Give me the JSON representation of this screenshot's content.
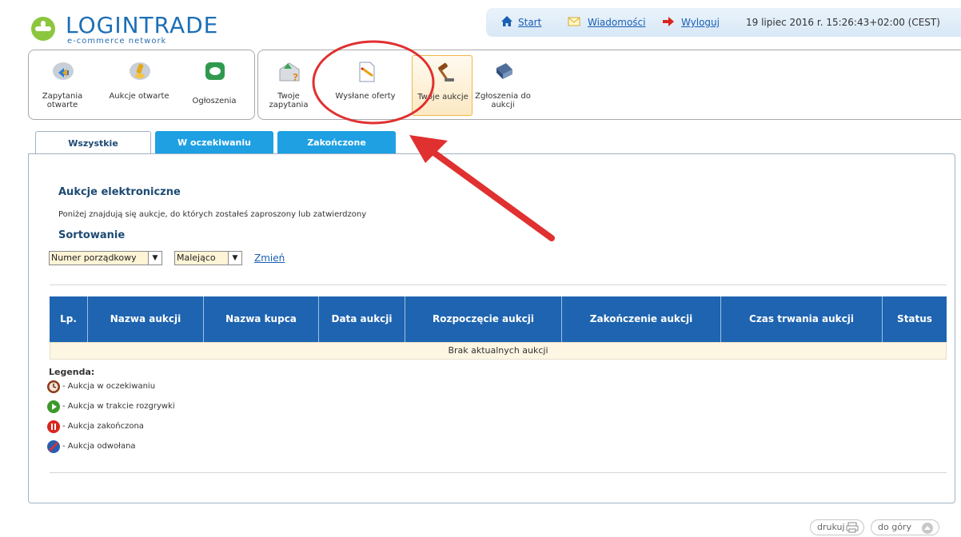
{
  "brand": {
    "name_part1": "LOGIN",
    "name_part2": "TRADE",
    "tagline": "e-commerce network"
  },
  "topbar": {
    "start": "Start",
    "messages": "Wiadomości",
    "logout": "Wyloguj",
    "datetime": "19 lipiec 2016 r. 15:26:43+02:00 (CEST)"
  },
  "panel_left": [
    {
      "label": "Zapytania otwarte",
      "icon": "speech-bubble-arrow-icon"
    },
    {
      "label": "Aukcje otwarte",
      "icon": "gavel-coin-icon"
    },
    {
      "label": "Ogłoszenia",
      "icon": "chat-bubble-icon"
    }
  ],
  "panel_right": [
    {
      "label": "Twoje zapytania",
      "icon": "envelope-question-icon"
    },
    {
      "label": "Wysłane oferty",
      "icon": "document-pen-icon"
    },
    {
      "label": "Twoje aukcje",
      "icon": "gavel-icon"
    },
    {
      "label": "Zgłoszenia do aukcji",
      "icon": "book-icon"
    }
  ],
  "tabs": [
    {
      "label": "Wszystkie"
    },
    {
      "label": "W oczekiwaniu"
    },
    {
      "label": "Zakończone"
    }
  ],
  "section": {
    "title": "Aukcje elektroniczne",
    "description": "Poniżej znajdują się aukcje, do których zostałeś zaproszony lub zatwierdzony",
    "sort_title": "Sortowanie",
    "sort_field": "Numer porządkowy",
    "sort_order": "Malejąco",
    "change_link": "Zmień"
  },
  "table": {
    "headers": [
      "Lp.",
      "Nazwa aukcji",
      "Nazwa kupca",
      "Data aukcji",
      "Rozpoczęcie aukcji",
      "Zakończenie aukcji",
      "Czas trwania aukcji",
      "Status"
    ],
    "empty_message": "Brak aktualnych aukcji"
  },
  "legend": {
    "title": "Legenda:",
    "items": [
      {
        "label": "- Aukcja w oczekiwaniu",
        "icon": "clock-icon",
        "color": "#8b3a1a"
      },
      {
        "label": "- Aukcja w trakcie rozgrywki",
        "icon": "play-icon",
        "color": "#3c9a2a"
      },
      {
        "label": "- Aukcja zakończona",
        "icon": "pause-icon",
        "color": "#d9241c"
      },
      {
        "label": "- Aukcja odwołana",
        "icon": "cancelled-icon",
        "color": "#2a5db0"
      }
    ]
  },
  "footer": {
    "print": "drukuj",
    "top": "do góry"
  },
  "colors": {
    "accent_blue": "#1e64b0",
    "tab_blue": "#1ea0e2",
    "annotation_red": "#e03030"
  }
}
